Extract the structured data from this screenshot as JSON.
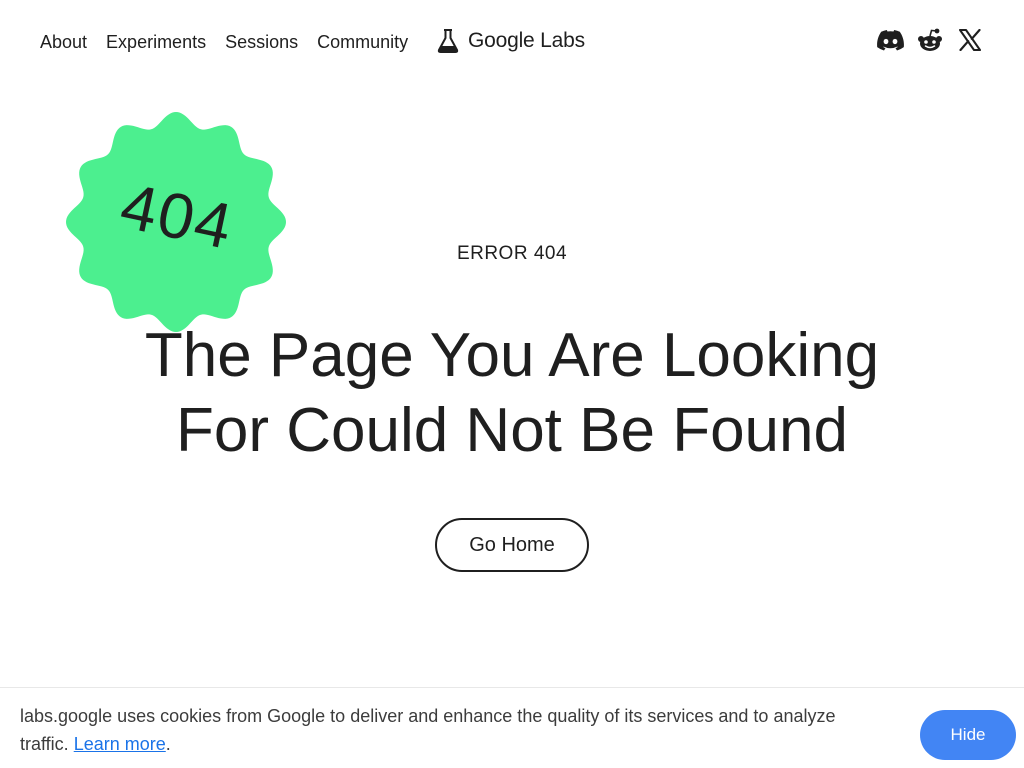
{
  "header": {
    "nav": [
      {
        "label": "About"
      },
      {
        "label": "Experiments"
      },
      {
        "label": "Sessions"
      },
      {
        "label": "Community"
      }
    ],
    "logo_text": "Google Labs",
    "social_icons": [
      "discord-icon",
      "reddit-icon",
      "x-icon"
    ]
  },
  "badge": {
    "text": "404",
    "color": "#4cef8f"
  },
  "main": {
    "error_label": "ERROR 404",
    "headline_line1": "The Page You Are Looking",
    "headline_line2": "For Could Not Be Found",
    "go_home_label": "Go Home"
  },
  "cookie": {
    "text": "labs.google uses cookies from Google to deliver and enhance the quality of its services and to analyze traffic.",
    "learn_more": "Learn more",
    "period": ".",
    "hide_label": "Hide",
    "accent": "#4285f4"
  }
}
